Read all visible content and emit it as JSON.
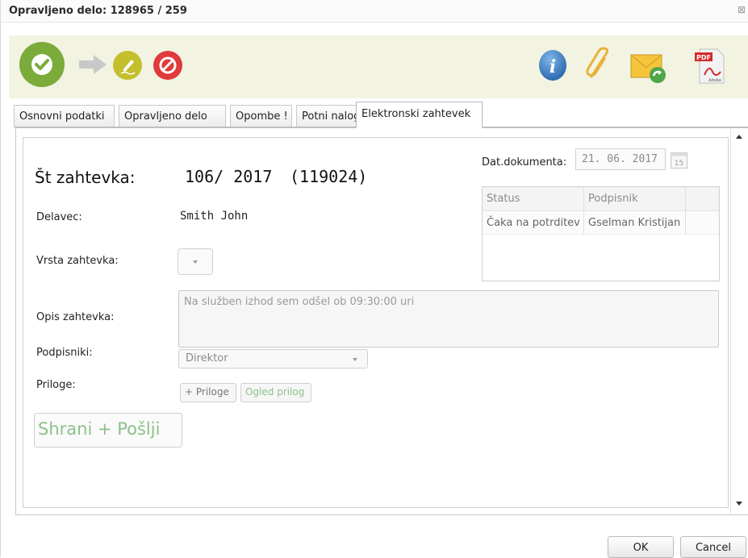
{
  "window": {
    "title": "Opravljeno delo: 128965 / 259",
    "close_glyph": "⊠"
  },
  "toolbar": {
    "icons": [
      "confirm-check-icon",
      "arrow-right-icon",
      "sign-pen-icon",
      "reject-stop-icon",
      "info-icon",
      "attachment-paperclip-icon",
      "mail-reply-icon",
      "pdf-adobe-icon"
    ],
    "pdf_label": "PDF",
    "pdf_sub": "Adobe",
    "colors": {
      "green": "#7bab3a",
      "yellow": "#c4bf2d",
      "red": "#e03a3a",
      "blue": "#2f78c0",
      "band": "#f3f3e2"
    }
  },
  "tabs": [
    {
      "label": "Osnovni podatki",
      "active": false
    },
    {
      "label": "Opravljeno delo",
      "active": false
    },
    {
      "label": "Opombe !",
      "active": false
    },
    {
      "label": "Potni nalog",
      "active": false
    },
    {
      "label": "Elektronski zahtevek",
      "active": true
    }
  ],
  "form": {
    "request_number_label": "Št zahtevka:",
    "request_number_value": "106/ 2017",
    "request_id": "(119024)",
    "worker_label": "Delavec:",
    "worker_value": "Smith John",
    "request_type_label": "Vrsta zahtevka:",
    "description_label": "Opis zahtevka:",
    "description_value": "Na služben izhod sem odšel ob 09:30:00 uri",
    "signers_label": "Podpisniki:",
    "signers_value": "Direktor",
    "attachments_label": "Priloge:",
    "add_attachment_button": "+ Priloge",
    "view_attachment_button": "Ogled prilog",
    "save_send_button": "Shrani + Pošlji",
    "doc_date_label": "Dat.dokumenta:",
    "doc_date_value": "21. 06. 2017",
    "calendar_day": "15"
  },
  "signers_grid": {
    "columns": [
      "Status",
      "Podpisnik"
    ],
    "rows": [
      [
        "Čaka na potrditev",
        "Gselman Kristijan"
      ]
    ]
  },
  "footer": {
    "ok_button": "OK",
    "cancel_button": "Cancel"
  }
}
